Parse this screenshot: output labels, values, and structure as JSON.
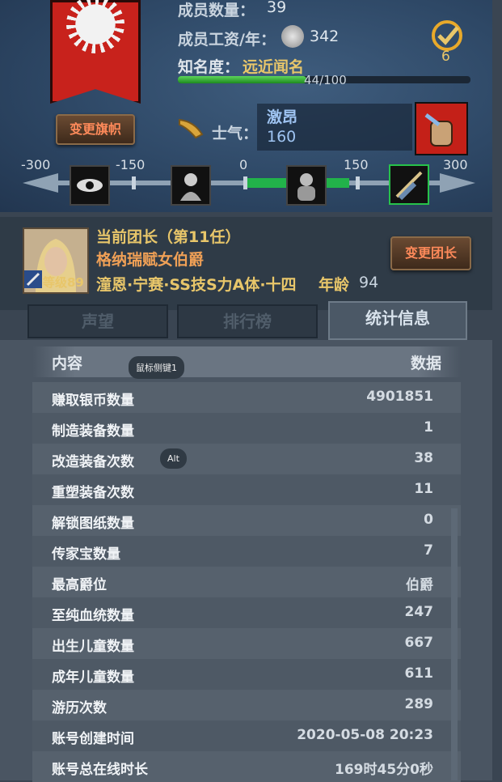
{
  "header": {
    "members_label": "成员数量：",
    "members_value": "39",
    "wage_label": "成员工资/年：",
    "wage_value": "342",
    "fame_label": "知名度：",
    "fame_value": "远近闻名",
    "fame_progress": "44/100",
    "fame_ratio": 0.44,
    "change_banner_button": "变更旗帜",
    "morale_label": "士气：",
    "morale_word": "激昂",
    "morale_value": "160",
    "badge_count": "6",
    "scale_labels": [
      "-300",
      "-150",
      "0",
      "150",
      "300"
    ],
    "scale_current": 160,
    "colors": {
      "accent": "#e8c66a",
      "banner": "#c8221c",
      "bar_green": "#22b24a"
    }
  },
  "leader": {
    "title": "当前团长（第11任）",
    "name": "格纳瑞赋女伯爵",
    "traits": "潼恩·宁赛·SS技S力A体·十四",
    "age_label": "年龄",
    "age_value": "94",
    "level": "等级89",
    "change_leader_button": "变更团长"
  },
  "tabs": [
    {
      "label": "声望"
    },
    {
      "label": "排行榜"
    },
    {
      "label": "统计信息"
    }
  ],
  "table": {
    "col_content": "内容",
    "col_data": "数据",
    "hint_mouse": "鼠标侧键1",
    "hint_alt": "Alt",
    "rows": [
      {
        "k": "赚取银币数量",
        "v": "4901851"
      },
      {
        "k": "制造装备数量",
        "v": "1"
      },
      {
        "k": "改造装备次数",
        "v": "38"
      },
      {
        "k": "重塑装备次数",
        "v": "11"
      },
      {
        "k": "解锁图纸数量",
        "v": "0"
      },
      {
        "k": "传家宝数量",
        "v": "7"
      },
      {
        "k": "最高爵位",
        "v": "伯爵"
      },
      {
        "k": "至纯血统数量",
        "v": "247"
      },
      {
        "k": "出生儿童数量",
        "v": "667"
      },
      {
        "k": "成年儿童数量",
        "v": "611"
      },
      {
        "k": "游历次数",
        "v": "289"
      },
      {
        "k": "账号创建时间",
        "v": "2020-05-08 20:23"
      },
      {
        "k": "账号总在线时长",
        "v": "169时45分0秒"
      }
    ]
  }
}
